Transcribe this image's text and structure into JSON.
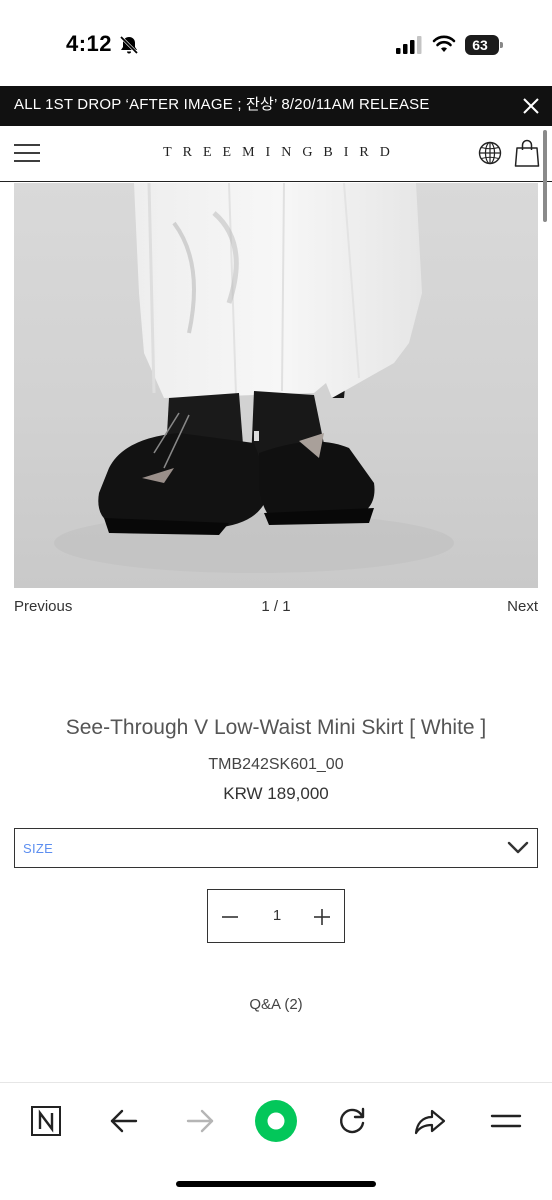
{
  "status_bar": {
    "time": "4:12",
    "battery_level": "63",
    "icons": [
      "bell-slash-icon",
      "cellular-signal-icon",
      "wifi-icon",
      "battery-icon"
    ]
  },
  "announcement": {
    "text": "ALL 1ST DROP ‘AFTER IMAGE ; 잔상’ 8/20/11AM RELEASE",
    "close_icon": "close-icon"
  },
  "header": {
    "logo": "TREEMINGBIRD",
    "icons": [
      "hamburger-menu-icon",
      "globe-icon",
      "shopping-bag-icon"
    ]
  },
  "gallery": {
    "previous_label": "Previous",
    "counter": "1 / 1",
    "next_label": "Next"
  },
  "product": {
    "name": "See-Through V Low-Waist Mini Skirt [ White ]",
    "code": "TMB242SK601_00",
    "price": "KRW 189,000"
  },
  "options": {
    "size_label": "SIZE",
    "chevron_icon": "chevron-down-icon"
  },
  "quantity": {
    "value": "1",
    "icons": [
      "minus-icon",
      "plus-icon"
    ]
  },
  "tabs": {
    "qna_label": "Q&A (2)"
  },
  "browser_toolbar": {
    "icons": [
      "naver-n-icon",
      "back-arrow-icon",
      "forward-arrow-icon",
      "green-dot-icon",
      "reload-icon",
      "share-icon",
      "menu-icon"
    ],
    "colors": {
      "accent_green": "#03c75a"
    }
  },
  "colors": {
    "announcement_bg": "#111111",
    "size_label": "#5c8ef0"
  }
}
